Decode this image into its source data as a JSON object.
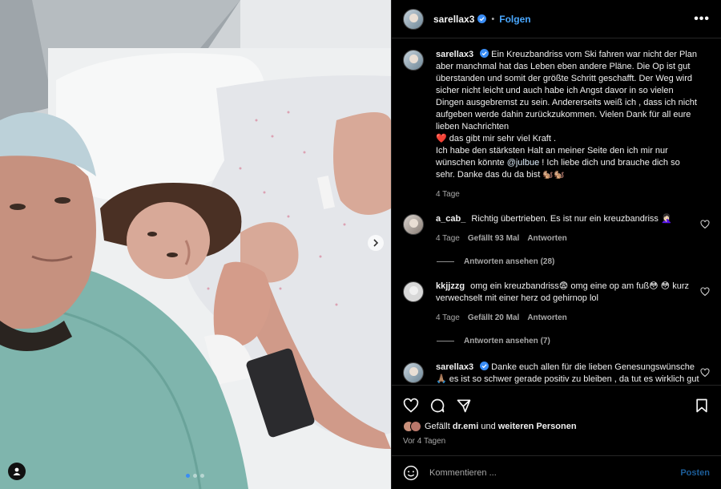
{
  "post": {
    "username": "sarellax3",
    "follow_label": "Folgen",
    "separator": "•",
    "caption_p1": "Ein Kreuzbandriss vom Ski fahren war nicht der Plan aber manchmal hat das Leben eben andere Pläne. Die Op ist gut überstanden und somit der größte Schritt geschafft. Der Weg wird sicher nicht leicht und auch habe ich Angst davor in so vielen Dingen ausgebremst zu sein. Andererseits weiß ich , dass ich nicht aufgeben werde dahin zurückzukommen. Vielen Dank für all eure lieben Nachrichten",
    "caption_heart": "❤️",
    "caption_p2": "das gibt mir sehr viel Kraft .",
    "caption_p3": "Ich habe den stärksten Halt an meiner Seite den ich mir nur wünschen könnte",
    "caption_mention": "@julbue",
    "caption_p4": "! Ich liebe dich und brauche dich so sehr. Danke das du da bist",
    "caption_emojis": "🐿️🐿️",
    "caption_time": "4 Tage"
  },
  "comments": [
    {
      "username": "a_cab_",
      "text": "Richtig übertrieben. Es ist nur ein kreuzbandriss 🤦🏻‍♀️",
      "time": "4 Tage",
      "likes": "Gefällt 93 Mal",
      "reply_label": "Antworten",
      "view_replies": "Antworten ansehen (28)"
    },
    {
      "username": "kkjjzzg",
      "text": "omg ein kreuzbandriss😨 omg eine op am fuß😳 😳 kurz verwechselt mit einer herz od gehirnop lol",
      "time": "4 Tage",
      "likes": "Gefällt 20 Mal",
      "reply_label": "Antworten",
      "view_replies": "Antworten ansehen (7)"
    },
    {
      "username": "sarellax3",
      "text": "Danke euch allen für die lieben Genesungswünsche 🙏🏽 es ist so schwer gerade positiv zu bleiben , da tut es wirklich gut solche lieben Nachrichten zu"
    }
  ],
  "likes_bar": {
    "prefix": "Gefällt",
    "user": "dr.emi",
    "middle": "und",
    "suffix": "weiteren Personen",
    "date": "Vor 4 Tagen"
  },
  "composer": {
    "placeholder": "Kommentieren ...",
    "post_label": "Posten"
  },
  "carousel": {
    "slides": 3,
    "active_index": 0
  },
  "colors": {
    "accent": "#4aa8ff",
    "verified": "#3a8df5",
    "panel_bg": "#000000",
    "muted": "#a8a8a8"
  }
}
